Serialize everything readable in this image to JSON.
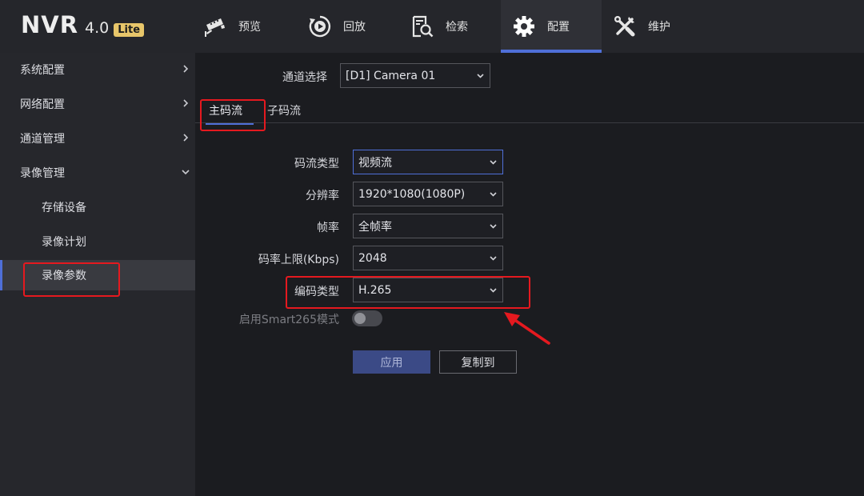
{
  "logo": {
    "main": "NVR",
    "version": "4.0",
    "badge": "Lite"
  },
  "nav": [
    {
      "label": "预览",
      "icon": "camera-icon"
    },
    {
      "label": "回放",
      "icon": "playback-icon"
    },
    {
      "label": "检索",
      "icon": "search-icon"
    },
    {
      "label": "配置",
      "icon": "gear-icon",
      "active": true
    },
    {
      "label": "维护",
      "icon": "tools-icon"
    }
  ],
  "sidebar": {
    "items": [
      {
        "label": "系统配置"
      },
      {
        "label": "网络配置"
      },
      {
        "label": "通道管理"
      },
      {
        "label": "录像管理"
      },
      {
        "label": "存储设备"
      },
      {
        "label": "录像计划"
      },
      {
        "label": "录像参数"
      }
    ]
  },
  "channel": {
    "label": "通道选择",
    "value": "[D1] Camera 01"
  },
  "tabs": [
    {
      "label": "主码流"
    },
    {
      "label": "子码流"
    }
  ],
  "form": {
    "stream_type": {
      "label": "码流类型",
      "value": "视频流"
    },
    "resolution": {
      "label": "分辨率",
      "value": "1920*1080(1080P)"
    },
    "frame_rate": {
      "label": "帧率",
      "value": "全帧率"
    },
    "bitrate_limit": {
      "label": "码率上限(Kbps)",
      "value": "2048"
    },
    "encoding": {
      "label": "编码类型",
      "value": "H.265"
    },
    "smart265": {
      "label": "启用Smart265模式",
      "enabled": false
    }
  },
  "buttons": {
    "apply": "应用",
    "copy_to": "复制到"
  },
  "colors": {
    "accent": "#4f6fd8",
    "annotation": "#e5191f",
    "logo_badge": "#e8c66a"
  }
}
